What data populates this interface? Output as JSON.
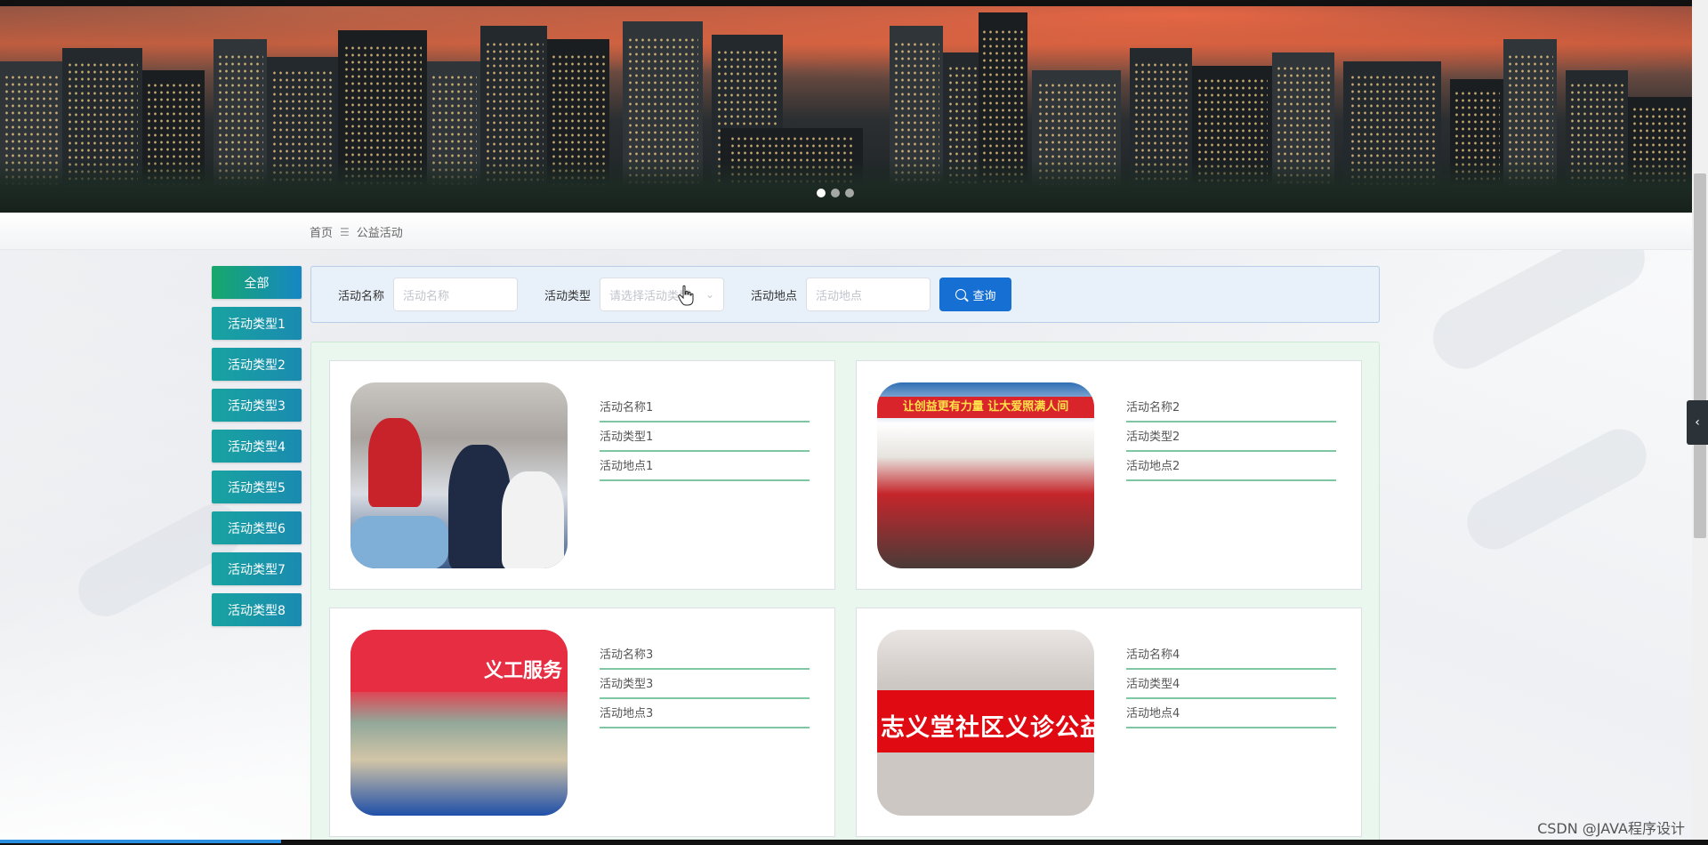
{
  "breadcrumb": {
    "home": "首页",
    "separator": "☰",
    "current": "公益活动"
  },
  "categories": [
    {
      "label": "全部"
    },
    {
      "label": "活动类型1"
    },
    {
      "label": "活动类型2"
    },
    {
      "label": "活动类型3"
    },
    {
      "label": "活动类型4"
    },
    {
      "label": "活动类型5"
    },
    {
      "label": "活动类型6"
    },
    {
      "label": "活动类型7"
    },
    {
      "label": "活动类型8"
    }
  ],
  "search": {
    "name_label": "活动名称",
    "name_placeholder": "活动名称",
    "type_label": "活动类型",
    "type_placeholder": "请选择活动类型",
    "location_label": "活动地点",
    "location_placeholder": "活动地点",
    "query_button": "查询"
  },
  "cards": [
    {
      "name": "活动名称1",
      "type": "活动类型1",
      "location": "活动地点1"
    },
    {
      "name": "活动名称2",
      "type": "活动类型2",
      "location": "活动地点2"
    },
    {
      "name": "活动名称3",
      "type": "活动类型3",
      "location": "活动地点3"
    },
    {
      "name": "活动名称4",
      "type": "活动类型4",
      "location": "活动地点4"
    }
  ],
  "image_texts": {
    "card2_banner": "让创益更有力量 让大爱照满人间",
    "card3_tent": "义工服务",
    "card4_strip": "志义堂社区义诊公益行"
  },
  "watermark": "CSDN @JAVA程序设计",
  "colors": {
    "primary": "#1670d3",
    "category_gradient_start": "#18a3a0",
    "category_gradient_end": "#1a8bb0",
    "line_green": "#7fc7a2"
  },
  "icons": {
    "search": "search-icon",
    "dropdown": "chevron-down-icon",
    "side_collapse": "chevron-left-icon"
  }
}
